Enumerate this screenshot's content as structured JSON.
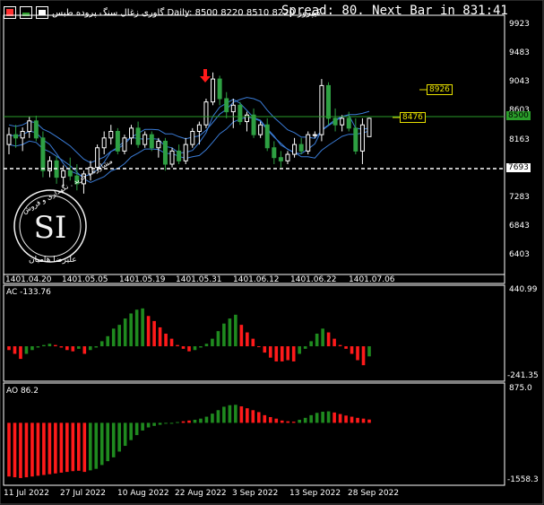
{
  "header": {
    "symbol_line": "گاوری زغال سنگ پروده طبس Daily: 8500 8220 8510 8220 کیپرور",
    "spread_text": "Spread: 80. Next Bar in 831:41"
  },
  "main_axis_ticks": [
    "9923",
    "9483",
    "9043",
    "8603",
    "8163",
    "7723",
    "7283",
    "6843",
    "6403"
  ],
  "main_x_labels": [
    "1401.04.20",
    "1401.05.05",
    "1401.05.19",
    "1401.05.31",
    "1401.06.12",
    "1401.06.22",
    "1401.07.06"
  ],
  "tags": {
    "current_price": "8500",
    "level_a": "8926",
    "level_b": "8476",
    "dashed_level": "7693"
  },
  "watermark": {
    "top_text": "مشاوره . خرید . نگهداری و فروش",
    "bottom_text": "علیرضا هامیان"
  },
  "ac_panel": {
    "label": "AC -133.76",
    "top_value": "440.99",
    "bottom_value": "-241.35"
  },
  "ao_panel": {
    "label": "AO 86.2",
    "top_value": "875.0",
    "bottom_value": "-1558.3"
  },
  "bottom_x_labels": [
    "11 Jul 2022",
    "27 Jul 2022",
    "10 Aug 2022",
    "22 Aug 2022",
    "3 Sep 2022",
    "13 Sep 2022",
    "28 Sep 2022"
  ],
  "colors": {
    "bull": "#1f8a1f",
    "bear": "#ff1a1a",
    "candle_up": "#ffffff",
    "candle_down": "#2ea043",
    "ma": "#3a7bd5",
    "level_line": "#2a9d2a",
    "tag_yellow": "#e8e100"
  },
  "chart_data": [
    {
      "type": "candlestick",
      "title": "Daily: 8500 8220 8510 8220",
      "x_start": "1401.04.20",
      "x_end": "1401.07.06",
      "ylim": [
        6100,
        10100
      ],
      "ohlc": [
        [
          8100,
          8360,
          7950,
          8250
        ],
        [
          8250,
          8400,
          8050,
          8200
        ],
        [
          8200,
          8360,
          8000,
          8300
        ],
        [
          8300,
          8520,
          8200,
          8460
        ],
        [
          8460,
          8540,
          8150,
          8200
        ],
        [
          8200,
          8300,
          7600,
          7700
        ],
        [
          7700,
          7920,
          7600,
          7850
        ],
        [
          7850,
          7920,
          7500,
          7600
        ],
        [
          7600,
          7780,
          7450,
          7700
        ],
        [
          7700,
          7900,
          7550,
          7620
        ],
        [
          7620,
          7800,
          7400,
          7500
        ],
        [
          7500,
          7700,
          7350,
          7650
        ],
        [
          7650,
          7850,
          7550,
          7750
        ],
        [
          7750,
          8100,
          7700,
          8050
        ],
        [
          8050,
          8300,
          7950,
          8200
        ],
        [
          8200,
          8400,
          8100,
          8300
        ],
        [
          8300,
          8350,
          7950,
          8000
        ],
        [
          8000,
          8250,
          7950,
          8200
        ],
        [
          8200,
          8400,
          8100,
          8350
        ],
        [
          8350,
          8450,
          8050,
          8100
        ],
        [
          8100,
          8300,
          8050,
          8250
        ],
        [
          8250,
          8300,
          8000,
          8050
        ],
        [
          8050,
          8200,
          7900,
          8150
        ],
        [
          8150,
          8200,
          7700,
          7800
        ],
        [
          7800,
          8050,
          7750,
          8000
        ],
        [
          8000,
          8100,
          7800,
          7850
        ],
        [
          7850,
          8200,
          7800,
          8100
        ],
        [
          8100,
          8350,
          8050,
          8300
        ],
        [
          8300,
          8450,
          8100,
          8400
        ],
        [
          8400,
          8800,
          8350,
          8750
        ],
        [
          8750,
          9200,
          8700,
          9100
        ],
        [
          9100,
          9150,
          8700,
          8800
        ],
        [
          8800,
          8900,
          8500,
          8600
        ],
        [
          8600,
          8800,
          8350,
          8700
        ],
        [
          8700,
          8750,
          8400,
          8450
        ],
        [
          8450,
          8600,
          8300,
          8550
        ],
        [
          8550,
          8650,
          8200,
          8250
        ],
        [
          8250,
          8450,
          8200,
          8400
        ],
        [
          8400,
          8500,
          8000,
          8050
        ],
        [
          8050,
          8150,
          7800,
          7900
        ],
        [
          7900,
          8000,
          7750,
          7850
        ],
        [
          7850,
          8000,
          7800,
          7950
        ],
        [
          7950,
          8200,
          7900,
          8100
        ],
        [
          8100,
          8200,
          7950,
          8000
        ],
        [
          8000,
          8300,
          7950,
          8250
        ],
        [
          8250,
          8300,
          8200,
          8250
        ],
        [
          8250,
          9100,
          8150,
          9000
        ],
        [
          9000,
          9050,
          8400,
          8500
        ],
        [
          8500,
          8650,
          8300,
          8400
        ],
        [
          8400,
          8550,
          8300,
          8500
        ],
        [
          8500,
          8600,
          8300,
          8350
        ],
        [
          8350,
          8500,
          7950,
          8000
        ],
        [
          8000,
          8500,
          7800,
          8400
        ],
        [
          8220,
          8510,
          8220,
          8500
        ]
      ]
    },
    {
      "type": "bar",
      "title": "AC -133.76",
      "ylim": [
        -241.35,
        440.99
      ],
      "values": [
        -30,
        -60,
        -100,
        -60,
        -30,
        -10,
        10,
        20,
        10,
        -10,
        -30,
        -40,
        -20,
        -60,
        -30,
        -10,
        40,
        80,
        140,
        170,
        220,
        260,
        290,
        300,
        240,
        200,
        150,
        100,
        60,
        10,
        -20,
        -40,
        -30,
        -10,
        20,
        60,
        120,
        180,
        220,
        250,
        170,
        110,
        60,
        0,
        -50,
        -90,
        -120,
        -120,
        -110,
        -120,
        -60,
        -20,
        40,
        100,
        140,
        110,
        60,
        10,
        -20,
        -60,
        -110,
        -150,
        -80
      ],
      "colors": [
        "r",
        "r",
        "r",
        "g",
        "g",
        "g",
        "g",
        "g",
        "r",
        "r",
        "r",
        "r",
        "g",
        "r",
        "g",
        "g",
        "g",
        "g",
        "g",
        "g",
        "g",
        "g",
        "g",
        "g",
        "r",
        "r",
        "r",
        "r",
        "r",
        "r",
        "r",
        "r",
        "g",
        "g",
        "g",
        "g",
        "g",
        "g",
        "g",
        "g",
        "r",
        "r",
        "r",
        "r",
        "r",
        "r",
        "r",
        "r",
        "r",
        "r",
        "g",
        "g",
        "g",
        "g",
        "g",
        "r",
        "r",
        "r",
        "r",
        "r",
        "r",
        "r",
        "g"
      ]
    },
    {
      "type": "bar",
      "title": "AO 86.2",
      "ylim": [
        -1558.3,
        875.0
      ],
      "values": [
        -1400,
        -1420,
        -1440,
        -1420,
        -1400,
        -1380,
        -1360,
        -1340,
        -1320,
        -1300,
        -1280,
        -1260,
        -1250,
        -1280,
        -1240,
        -1200,
        -1100,
        -1000,
        -900,
        -750,
        -600,
        -450,
        -320,
        -200,
        -120,
        -80,
        -50,
        -20,
        0,
        20,
        40,
        60,
        80,
        110,
        160,
        240,
        330,
        420,
        460,
        470,
        430,
        380,
        330,
        280,
        200,
        150,
        110,
        60,
        40,
        30,
        80,
        130,
        200,
        260,
        290,
        300,
        270,
        230,
        190,
        160,
        130,
        110,
        86
      ],
      "colors": [
        "r",
        "r",
        "r",
        "r",
        "r",
        "r",
        "r",
        "r",
        "r",
        "r",
        "r",
        "r",
        "r",
        "r",
        "g",
        "g",
        "g",
        "g",
        "g",
        "g",
        "g",
        "g",
        "g",
        "g",
        "g",
        "g",
        "g",
        "g",
        "g",
        "g",
        "r",
        "r",
        "g",
        "g",
        "g",
        "g",
        "g",
        "g",
        "g",
        "g",
        "r",
        "r",
        "r",
        "r",
        "r",
        "r",
        "r",
        "r",
        "r",
        "r",
        "g",
        "g",
        "g",
        "g",
        "g",
        "g",
        "r",
        "r",
        "r",
        "r",
        "r",
        "r",
        "r"
      ]
    }
  ]
}
